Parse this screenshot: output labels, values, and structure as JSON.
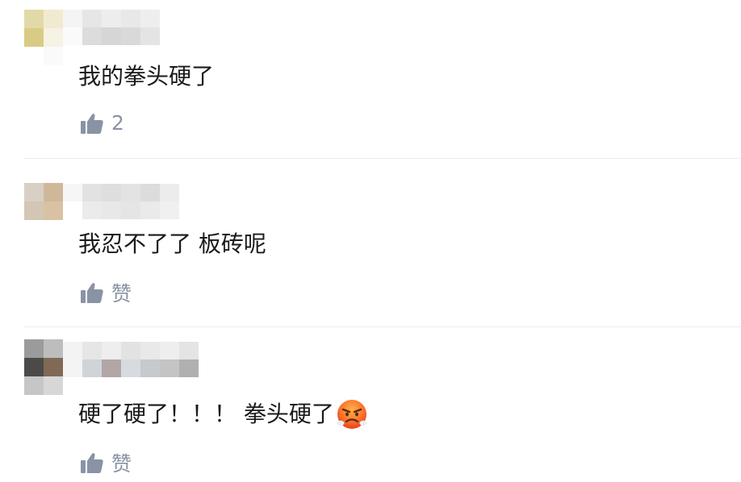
{
  "comments": [
    {
      "text": "我的拳头硬了",
      "likes": "2"
    },
    {
      "text": "我忍不了了 板砖呢",
      "likes": "赞"
    },
    {
      "text": "硬了硬了！！！ 拳头硬了",
      "likes": "赞",
      "emoji": "angry-face-icon"
    }
  ],
  "colors": {
    "text": "#1a1a1a",
    "like": "#8a93a5",
    "divider": "#ececec"
  }
}
